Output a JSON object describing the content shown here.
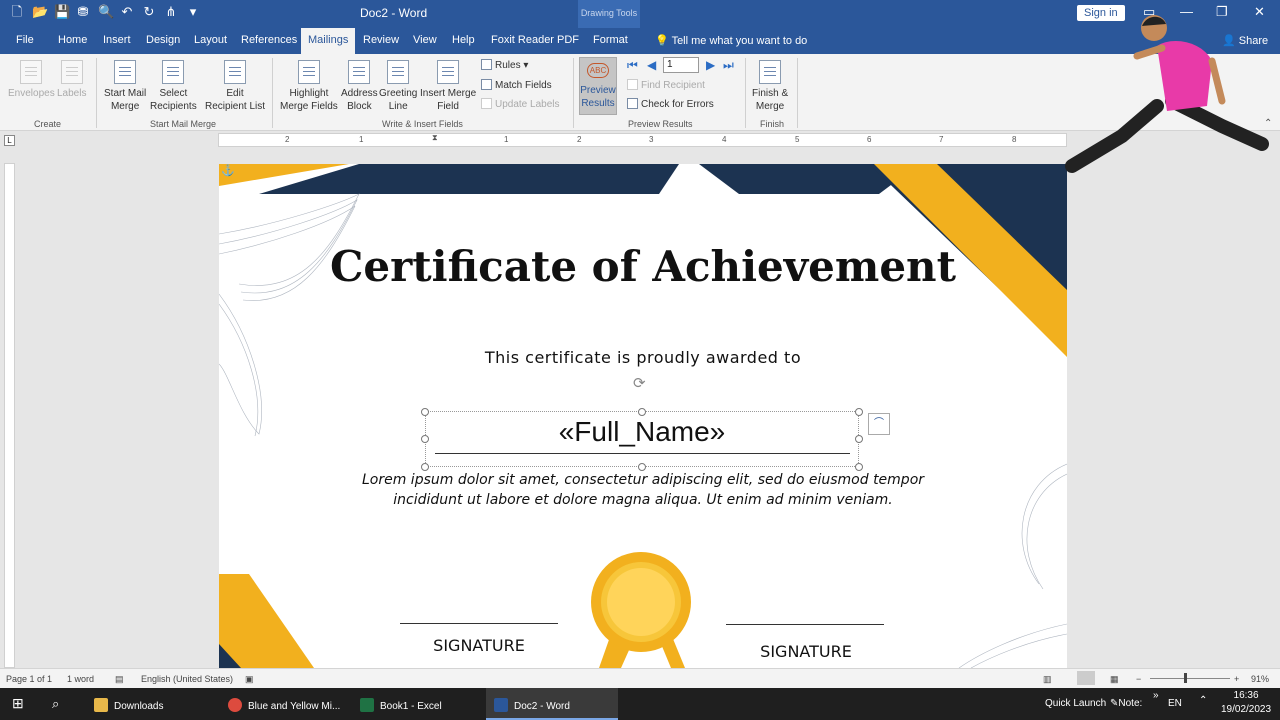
{
  "title_bar": {
    "doc_title": "Doc2 - Word",
    "context_group": "Drawing Tools",
    "sign_in": "Sign in"
  },
  "tabs": [
    "File",
    "Home",
    "Insert",
    "Design",
    "Layout",
    "References",
    "Mailings",
    "Review",
    "View",
    "Help",
    "Foxit Reader PDF",
    "Format"
  ],
  "active_tab": "Mailings",
  "tell_me": "Tell me what you want to do",
  "share": "Share",
  "ribbon": {
    "create": {
      "envelopes": "Envelopes",
      "labels": "Labels",
      "group": "Create"
    },
    "start_mail_merge": {
      "start": "Start Mail\nMerge",
      "select": "Select\nRecipients",
      "edit": "Edit\nRecipient List",
      "group": "Start Mail Merge"
    },
    "write_insert": {
      "highlight": "Highlight\nMerge Fields",
      "address": "Address\nBlock",
      "greeting": "Greeting\nLine",
      "insert_field": "Insert Merge\nField",
      "rules": "Rules",
      "match": "Match Fields",
      "update": "Update Labels",
      "group": "Write & Insert Fields"
    },
    "preview": {
      "preview_results": "Preview\nResults",
      "record": "1",
      "find": "Find Recipient",
      "check": "Check for Errors",
      "group": "Preview Results"
    },
    "finish": {
      "finish_merge": "Finish &\nMerge",
      "group": "Finish"
    }
  },
  "ruler_numbers": [
    "2",
    "1",
    "1",
    "2",
    "3",
    "4",
    "5",
    "6",
    "7",
    "8"
  ],
  "document": {
    "title": "Certificate of Achievement",
    "subtitle": "This certificate is proudly awarded to",
    "merge_field": "«Full_Name»",
    "lorem": "Lorem ipsum dolor sit amet, consectetur adipiscing elit, sed do eiusmod tempor incididunt ut labore et dolore magna aliqua. Ut enim ad minim veniam.",
    "signature_left": "SIGNATURE",
    "signature_right": "SIGNATURE"
  },
  "colors": {
    "navy": "#1c3351",
    "gold": "#f2b01e",
    "word_blue": "#2b579a"
  },
  "status": {
    "page": "Page 1 of 1",
    "words": "1 word",
    "language": "English (United States)",
    "zoom": "91%"
  },
  "taskbar": {
    "items": [
      "Downloads",
      "Blue and Yellow Mi...",
      "Book1 - Excel",
      "Doc2 - Word"
    ],
    "quick_launch": "Quick Launch",
    "note": "Note:",
    "lang": "EN",
    "time": "16:36",
    "date": "19/02/2023"
  }
}
